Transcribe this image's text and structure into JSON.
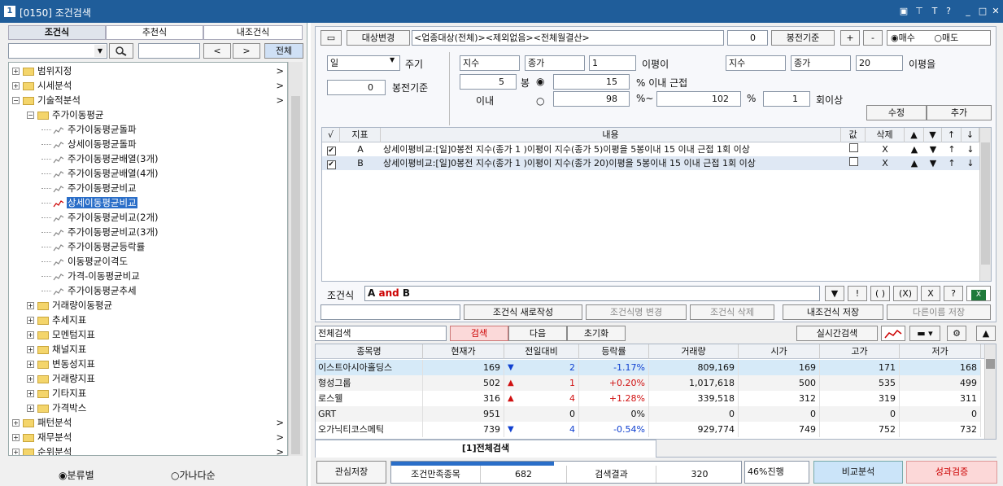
{
  "window": {
    "num": "1",
    "title": "[0150] 조건검색"
  },
  "left": {
    "tabs": [
      "조건식",
      "추천식",
      "내조건식"
    ],
    "all_btn": "전체",
    "tree": [
      {
        "label": "범위지정",
        "level": 0,
        "type": "folder",
        "arrow": ">"
      },
      {
        "label": "시세분석",
        "level": 0,
        "type": "folder",
        "arrow": ">"
      },
      {
        "label": "기술적분석",
        "level": 0,
        "type": "folder",
        "arrow": ">",
        "expanded": true
      },
      {
        "label": "주가이동평균",
        "level": 1,
        "type": "folder",
        "expanded": true
      },
      {
        "label": "주가이동평균돌파",
        "level": 2,
        "type": "leaf"
      },
      {
        "label": "상세이동평균돌파",
        "level": 2,
        "type": "leaf"
      },
      {
        "label": "주가이동평균배열(3개)",
        "level": 2,
        "type": "leaf"
      },
      {
        "label": "주가이동평균배열(4개)",
        "level": 2,
        "type": "leaf"
      },
      {
        "label": "주가이동평균비교",
        "level": 2,
        "type": "leaf"
      },
      {
        "label": "상세이동평균비교",
        "level": 2,
        "type": "leaf",
        "selected": true
      },
      {
        "label": "주가이동평균비교(2개)",
        "level": 2,
        "type": "leaf"
      },
      {
        "label": "주가이동평균비교(3개)",
        "level": 2,
        "type": "leaf"
      },
      {
        "label": "주가이동평균등락률",
        "level": 2,
        "type": "leaf"
      },
      {
        "label": "이동평균이격도",
        "level": 2,
        "type": "leaf"
      },
      {
        "label": "가격-이동평균비교",
        "level": 2,
        "type": "leaf"
      },
      {
        "label": "주가이동평균추세",
        "level": 2,
        "type": "leaf"
      },
      {
        "label": "거래량이동평균",
        "level": 1,
        "type": "folder"
      },
      {
        "label": "추세지표",
        "level": 1,
        "type": "folder"
      },
      {
        "label": "모멘텀지표",
        "level": 1,
        "type": "folder"
      },
      {
        "label": "채널지표",
        "level": 1,
        "type": "folder"
      },
      {
        "label": "변동성지표",
        "level": 1,
        "type": "folder"
      },
      {
        "label": "거래량지표",
        "level": 1,
        "type": "folder"
      },
      {
        "label": "기타지표",
        "level": 1,
        "type": "folder"
      },
      {
        "label": "가격박스",
        "level": 1,
        "type": "folder"
      },
      {
        "label": "패턴분석",
        "level": 0,
        "type": "folder",
        "arrow": ">"
      },
      {
        "label": "재무분석",
        "level": 0,
        "type": "folder",
        "arrow": ">"
      },
      {
        "label": "순위분석",
        "level": 0,
        "type": "folder",
        "arrow": ">"
      }
    ],
    "radio1": "분류별",
    "radio2": "가나다순"
  },
  "top": {
    "target_btn": "대상변경",
    "target_text": "<업종대상(전체)><제외없음><전체월결산>",
    "bong_val": "0",
    "bong_btn": "봉전기준",
    "plus": "+",
    "minus": "-",
    "buy": "매수",
    "sell": "매도"
  },
  "params": {
    "period": "일",
    "period_lbl": "주기",
    "bong2_val": "0",
    "bong2_lbl": "봉전기준",
    "sel1": "지수",
    "sel2": "종가",
    "sel3": "1",
    "lbl1": "이평이",
    "sel4": "지수",
    "sel5": "종가",
    "sel6": "20",
    "lbl2": "이평을",
    "n_bong": "5",
    "bong_unit": "봉",
    "within": "이내",
    "v15": "15",
    "pct_near": "% 이내 근접",
    "v98": "98",
    "pct_tilde": "%~",
    "v102": "102",
    "pct": "%",
    "v1": "1",
    "times": "회이상",
    "edit_btn": "수정",
    "add_btn": "추가"
  },
  "cond_table": {
    "headers": [
      "√",
      "지표",
      "내용",
      "값",
      "삭제",
      "▲",
      "▼",
      "↑",
      "↓"
    ],
    "rows": [
      {
        "check": "✔",
        "id": "A",
        "content": "상세이평비교:[일]0봉전 지수(종가 1 )이평이 지수(종가 5)이평을 5봉이내 15 이내 근접 1회 이상",
        "del": "X"
      },
      {
        "check": "✔",
        "id": "B",
        "content": "상세이평비교:[일]0봉전 지수(종가 1 )이평이 지수(종가 20)이평을 5봉이내 15 이내 근접 1회 이상",
        "del": "X"
      }
    ]
  },
  "formula": {
    "label": "조건식",
    "prefix": "A",
    "op": "and",
    "suffix": "B",
    "btns": [
      "▼",
      "!",
      "( )",
      "(X)",
      "X",
      "?"
    ]
  },
  "actions": [
    "조건식 새로작성",
    "조건식명 변경",
    "조건식 삭제",
    "내조건식 저장",
    "다른이름 저장"
  ],
  "search": {
    "scope": "전체검색",
    "search": "검색",
    "next": "다음",
    "reset": "초기화",
    "realtime": "실시간검색"
  },
  "results": {
    "headers": [
      "종목명",
      "현재가",
      "전일대비",
      "등락률",
      "거래량",
      "시가",
      "고가",
      "저가"
    ],
    "rows": [
      {
        "name": "이스트아시아홀딩스",
        "price": "169",
        "dir": "down",
        "diff": "2",
        "rate": "-1.17%",
        "vol": "809,169",
        "open": "169",
        "high": "171",
        "low": "168"
      },
      {
        "name": "형성그룹",
        "price": "502",
        "dir": "up",
        "diff": "1",
        "rate": "+0.20%",
        "vol": "1,017,618",
        "open": "500",
        "high": "535",
        "low": "499"
      },
      {
        "name": "로스웰",
        "price": "316",
        "dir": "up",
        "diff": "4",
        "rate": "+1.28%",
        "vol": "339,518",
        "open": "312",
        "high": "319",
        "low": "311"
      },
      {
        "name": "GRT",
        "price": "951",
        "dir": "",
        "diff": "0",
        "rate": "0%",
        "vol": "0",
        "open": "0",
        "high": "0",
        "low": "0"
      },
      {
        "name": "오가닉티코스메틱",
        "price": "739",
        "dir": "down",
        "diff": "4",
        "rate": "-0.54%",
        "vol": "929,774",
        "open": "749",
        "high": "752",
        "low": "732"
      }
    ]
  },
  "bottom": {
    "tab": "[1]전체검색",
    "watch": "관심저장",
    "match_lbl": "조건만족종목",
    "match_val": "682",
    "res_lbl": "검색결과",
    "res_val": "320",
    "progress": "46%진행",
    "compare": "비교분석",
    "perf": "성과검증"
  },
  "colors": {
    "title": "#1f5d9a",
    "up": "#d01010",
    "down": "#1040d0"
  }
}
